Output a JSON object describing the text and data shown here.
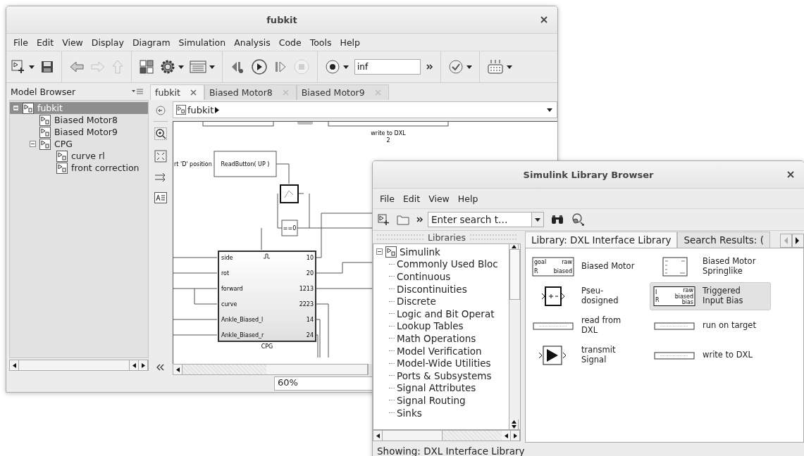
{
  "main_window": {
    "title": "fubkit",
    "menu": [
      "File",
      "Edit",
      "View",
      "Display",
      "Diagram",
      "Simulation",
      "Analysis",
      "Code",
      "Tools",
      "Help"
    ],
    "stop_time": "inf",
    "model_browser": {
      "title": "Model Browser",
      "tree": [
        {
          "label": "fubkit",
          "selected": true,
          "expanded": true,
          "children": [
            {
              "label": "Biased Motor8",
              "selected": false
            },
            {
              "label": "Biased Motor9",
              "selected": false
            },
            {
              "label": "CPG",
              "selected": false,
              "expanded": true,
              "children": [
                {
                  "label": "curve rl",
                  "selected": false
                },
                {
                  "label": "front correction",
                  "selected": false
                }
              ]
            }
          ]
        }
      ]
    },
    "tabs": [
      {
        "label": "fubkit",
        "selected": true
      },
      {
        "label": "Biased Motor8",
        "selected": false
      },
      {
        "label": "Biased Motor9",
        "selected": false
      }
    ],
    "breadcrumb": "fubkit",
    "diagram": {
      "write_block": {
        "label": "write to DXL",
        "port": "2"
      },
      "read_block": {
        "text": "ReadButton( UP )",
        "side_label": "rt 'D' position"
      },
      "compare_block": "==0",
      "cpg": {
        "name": "CPG",
        "inputs": [
          "side",
          "rot",
          "forward",
          "curve",
          "Ankle_Biased_l",
          "Ankle_Biased_r"
        ],
        "outputs": [
          "10",
          "20",
          "1213",
          "2223",
          "14",
          "24"
        ]
      }
    },
    "zoom": "60%"
  },
  "library_browser": {
    "title": "Simulink Library Browser",
    "menu": [
      "File",
      "Edit",
      "View",
      "Help"
    ],
    "search": {
      "placeholder": "Enter search t…"
    },
    "libraries_title": "Libraries",
    "tree": [
      {
        "label": "Simulink",
        "expanded": true,
        "children": [
          {
            "label": "Commonly Used Bloc"
          },
          {
            "label": "Continuous"
          },
          {
            "label": "Discontinuities"
          },
          {
            "label": "Discrete"
          },
          {
            "label": "Logic and Bit Operat"
          },
          {
            "label": "Lookup Tables"
          },
          {
            "label": "Math Operations"
          },
          {
            "label": "Model Verification"
          },
          {
            "label": "Model-Wide Utilities"
          },
          {
            "label": "Ports & Subsystems"
          },
          {
            "label": "Signal Attributes"
          },
          {
            "label": "Signal Routing"
          },
          {
            "label": "Sinks"
          }
        ]
      }
    ],
    "tabs": [
      {
        "label": "Library: DXL Interface Library",
        "selected": true
      },
      {
        "label": "Search Results: (",
        "selected": false
      }
    ],
    "blocks": [
      {
        "label": "Biased Motor",
        "kind": "motor",
        "selected": false,
        "inputs": [
          "goal",
          "R"
        ],
        "outputs": [
          "raw",
          "biased"
        ]
      },
      {
        "label": "Biased Motor\nSpringlike",
        "kind": "motor4",
        "selected": false
      },
      {
        "label": "Pseu-\ndosigned",
        "kind": "sum",
        "selected": false
      },
      {
        "label": "Triggered\nInput Bias",
        "kind": "triggered",
        "selected": true,
        "inputs": [
          "I",
          "R"
        ],
        "outputs": [
          "raw",
          "biased",
          "bias"
        ]
      },
      {
        "label": "read from\nDXL",
        "kind": "wide",
        "selected": false
      },
      {
        "label": "run on target",
        "kind": "wide",
        "selected": false
      },
      {
        "label": "transmit\nSignal",
        "kind": "gain",
        "selected": false
      },
      {
        "label": "write to DXL",
        "kind": "wide",
        "selected": false
      }
    ],
    "status": "Showing: DXL Interface Library"
  }
}
